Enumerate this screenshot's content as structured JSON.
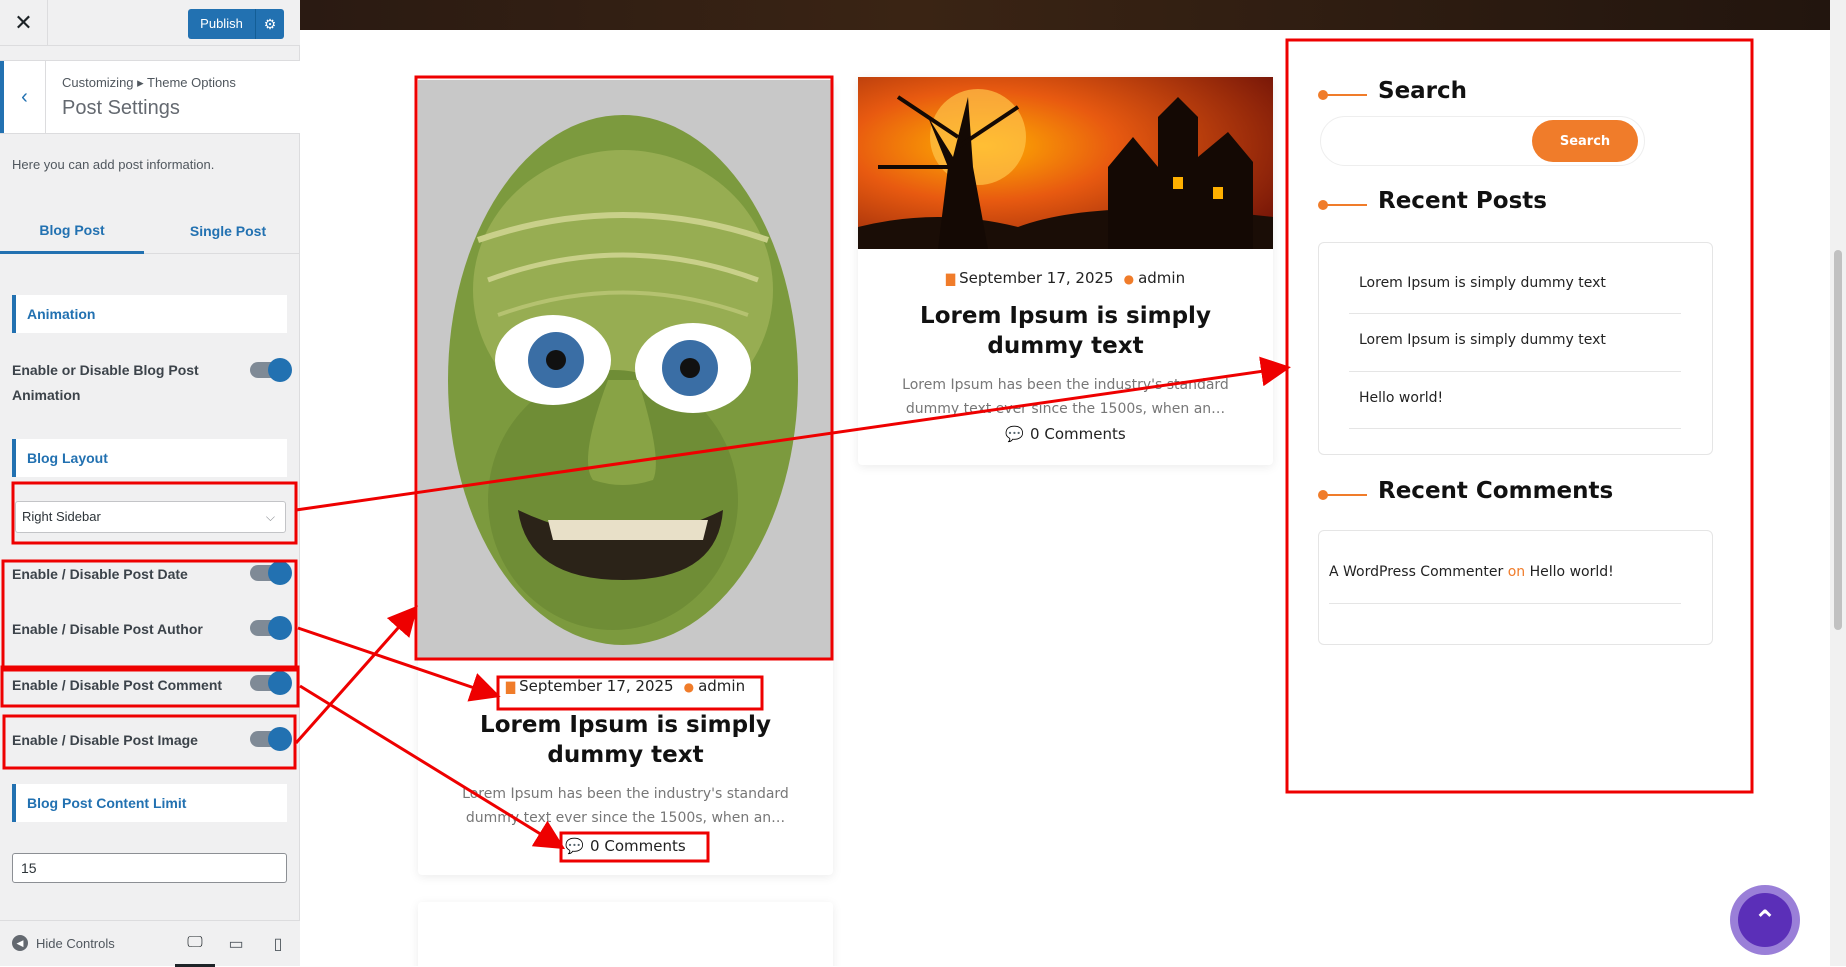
{
  "topbar": {
    "close_icon": "close-icon",
    "publish_label": "Publish",
    "gear_icon": "gear-icon"
  },
  "section": {
    "breadcrumb": "Customizing ▸ Theme Options",
    "title": "Post Settings",
    "description": "Here you can add post information."
  },
  "tabs": [
    {
      "label": "Blog Post",
      "active": true
    },
    {
      "label": "Single Post",
      "active": false
    }
  ],
  "controls": {
    "animation_head": "Animation",
    "animation_toggle_label": "Enable or Disable Blog Post Animation",
    "layout_head": "Blog Layout",
    "layout_value": "Right Sidebar",
    "date_label": "Enable / Disable Post Date",
    "author_label": "Enable / Disable Post Author",
    "comment_label": "Enable / Disable Post Comment",
    "image_label": "Enable / Disable Post Image",
    "content_limit_head": "Blog Post Content Limit",
    "content_limit_value": "15"
  },
  "footer": {
    "hide_controls": "Hide Controls",
    "devices": [
      "desktop-icon",
      "tablet-icon",
      "mobile-icon"
    ]
  },
  "posts": [
    {
      "date": "September 17, 2025",
      "author": "admin",
      "title": "Lorem Ipsum is simply dummy text",
      "excerpt": "Lorem Ipsum has been the industry's standard dummy text ever since the 1500s, when an…",
      "comments": "0 Comments"
    },
    {
      "date": "September 17, 2025",
      "author": "admin",
      "title": "Lorem Ipsum is simply dummy text",
      "excerpt": "Lorem Ipsum has been the industry's standard dummy text ever since the 1500s, when an…",
      "comments": "0 Comments"
    }
  ],
  "sidebar_widgets": {
    "search_title": "Search",
    "search_button": "Search",
    "recent_posts_title": "Recent Posts",
    "recent_posts": [
      "Lorem Ipsum is simply dummy text",
      "Lorem Ipsum is simply dummy text",
      "Hello world!"
    ],
    "recent_comments_title": "Recent Comments",
    "comment_author": "A WordPress Commenter",
    "comment_on": "on",
    "comment_post": "Hello world!"
  },
  "colors": {
    "accent": "#f07c2a",
    "wp_blue": "#2271b1",
    "annotation_red": "#ff0000"
  }
}
